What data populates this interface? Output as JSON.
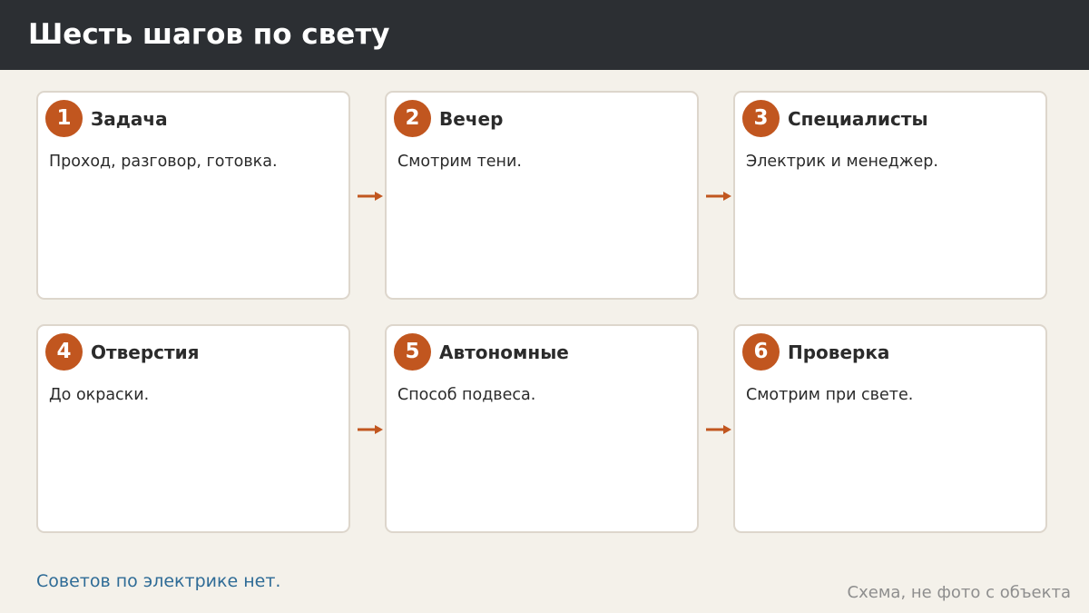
{
  "header": {
    "title": "Шесть шагов по свету"
  },
  "steps": [
    {
      "number": "1",
      "title": "Задача",
      "text": "Проход, разговор, готовка."
    },
    {
      "number": "2",
      "title": "Вечер",
      "text": "Смотрим тени."
    },
    {
      "number": "3",
      "title": "Специалисты",
      "text": "Электрик и менеджер."
    },
    {
      "number": "4",
      "title": "Отверстия",
      "text": "До окраски."
    },
    {
      "number": "5",
      "title": "Автономные",
      "text": "Способ подвеса."
    },
    {
      "number": "6",
      "title": "Проверка",
      "text": "Смотрим при свете."
    }
  ],
  "footer": {
    "note": "Советов по электрике нет.",
    "caption": "Схема, не фото с объекта"
  },
  "colors": {
    "header_bg": "#2c2f33",
    "accent": "#c1561f",
    "background": "#f4f1ea",
    "link": "#2e6b96"
  }
}
